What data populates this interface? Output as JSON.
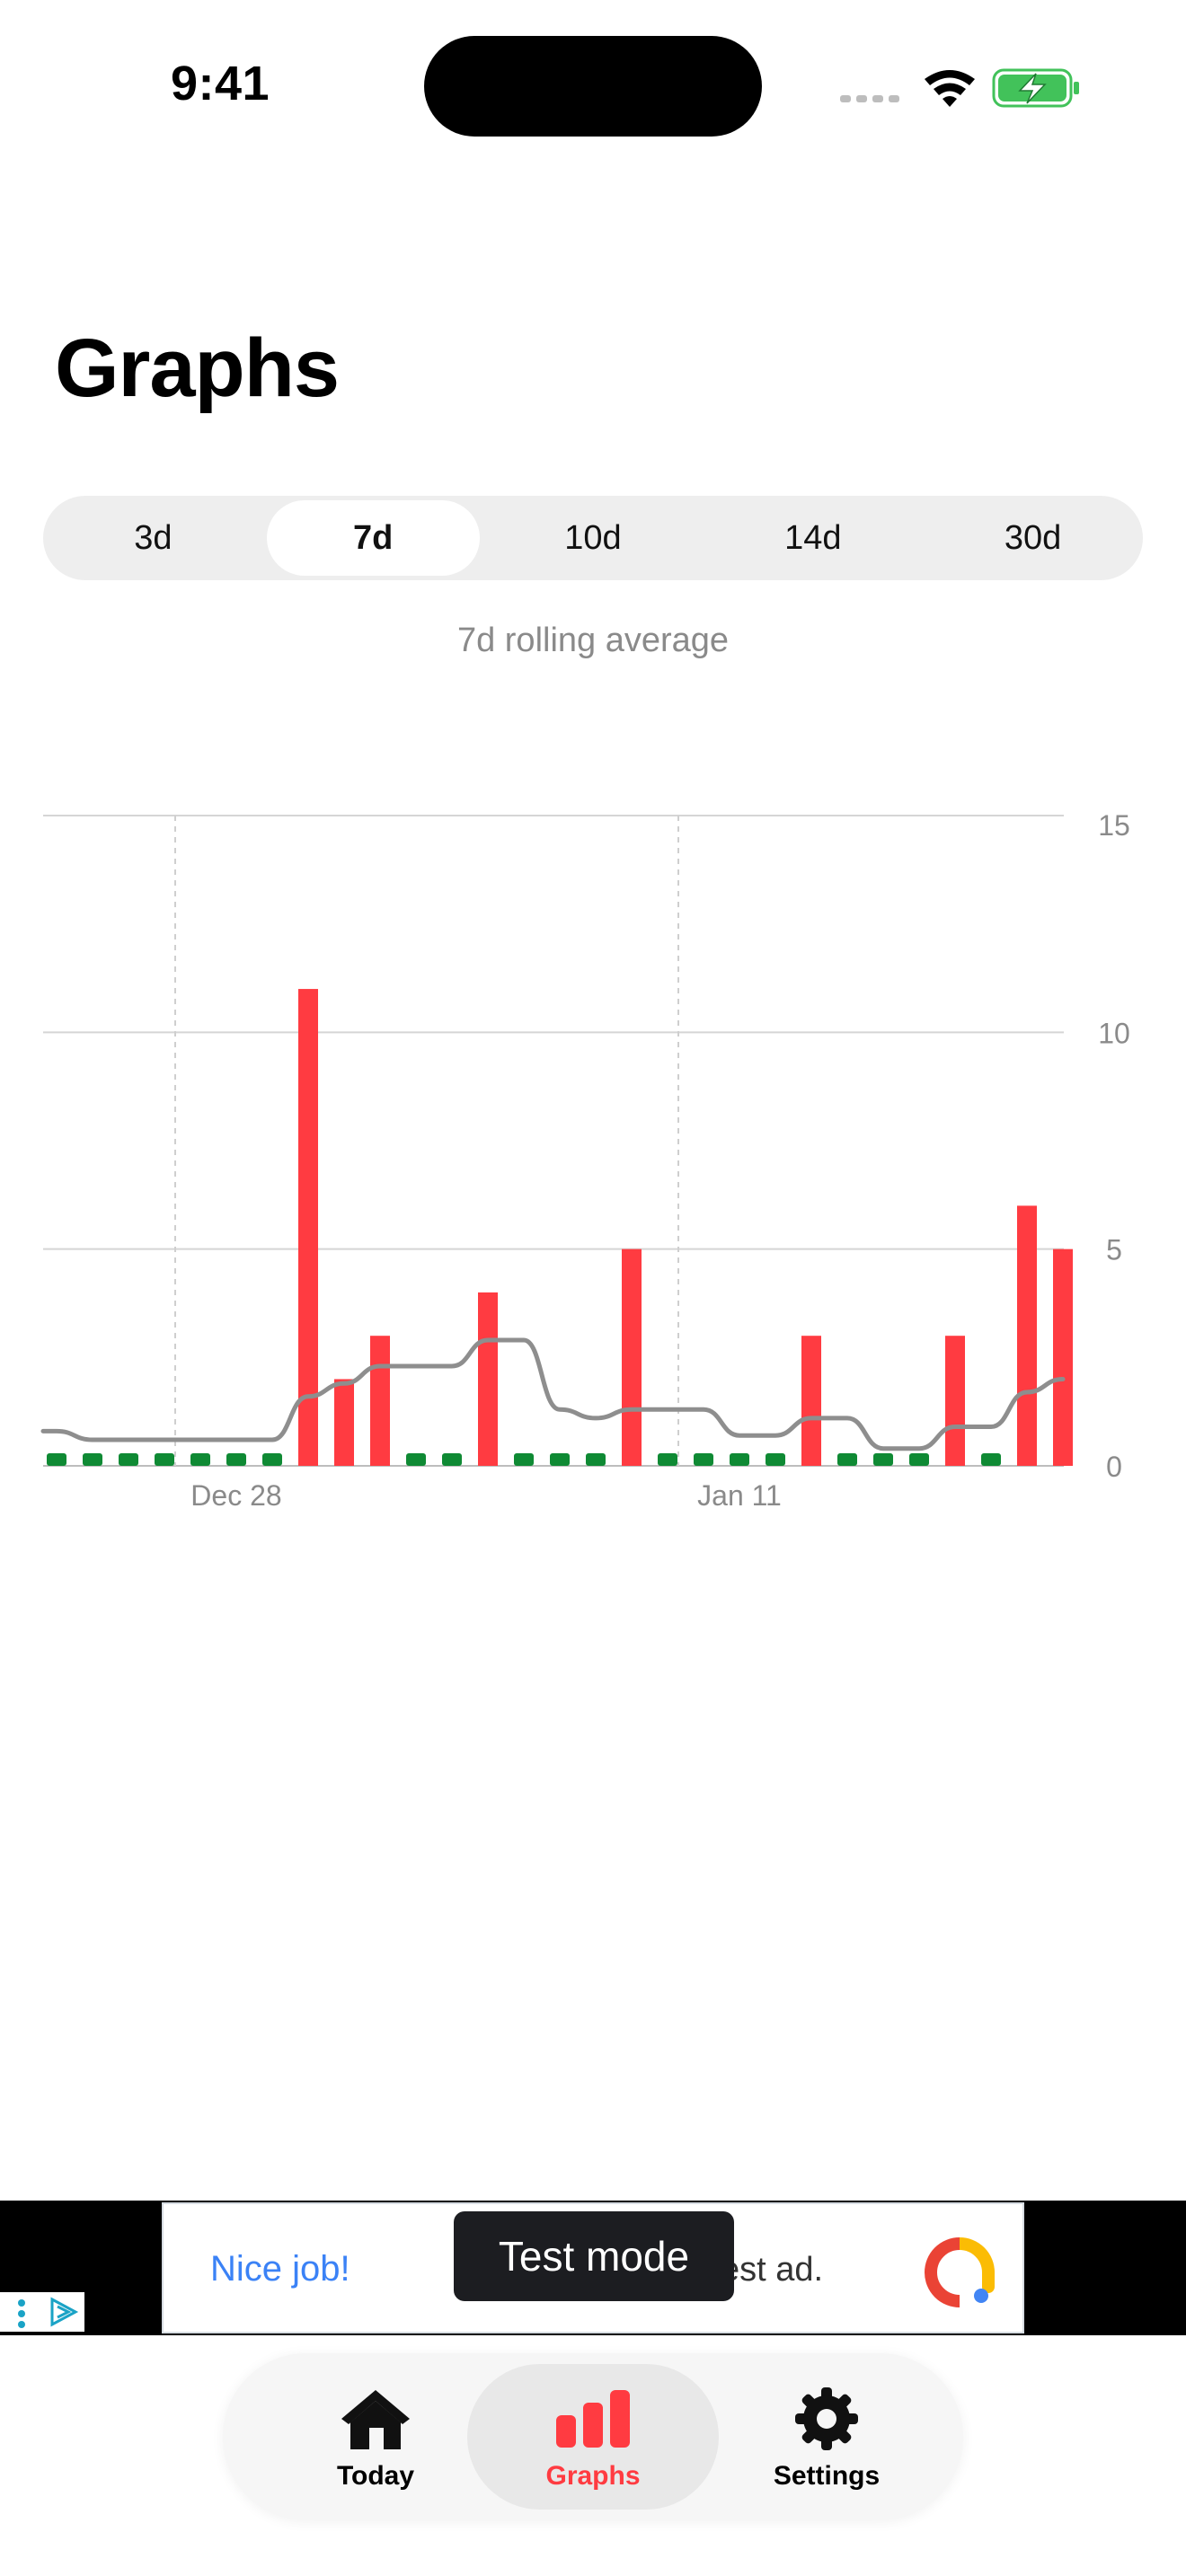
{
  "status_bar": {
    "time": "9:41"
  },
  "page": {
    "title": "Graphs",
    "subtitle": "7d rolling average"
  },
  "range_selector": {
    "options": [
      "3d",
      "7d",
      "10d",
      "14d",
      "30d"
    ],
    "selected": "7d"
  },
  "chart_data": {
    "type": "bar",
    "y_axis": {
      "ticks": [
        "15",
        "10",
        "5",
        "0"
      ],
      "ylim": [
        0,
        15
      ],
      "position": "right"
    },
    "x_axis": {
      "tick_labels": [
        "Dec 28",
        "Jan 11"
      ]
    },
    "grid": true,
    "values": [
      0,
      0,
      0,
      0,
      0,
      0,
      0,
      11,
      2,
      3,
      0,
      0,
      4,
      0,
      0,
      0,
      5,
      0,
      0,
      0,
      0,
      3,
      0,
      0,
      0,
      3,
      0,
      6,
      5
    ],
    "rolling_average": [
      0.8,
      0.6,
      0.6,
      0.6,
      0.6,
      0.6,
      0.6,
      1.6,
      1.9,
      2.3,
      2.3,
      2.3,
      2.9,
      2.9,
      1.3,
      1.1,
      1.3,
      1.3,
      1.3,
      0.7,
      0.7,
      1.1,
      1.1,
      0.4,
      0.4,
      0.9,
      0.9,
      1.7,
      2.0
    ],
    "colors": {
      "positive": "#ff3b41",
      "zero": "#0f8a34",
      "average_line": "#8e8e8e"
    }
  },
  "ad": {
    "headline": "Nice job!",
    "body_fragment": "est ad.",
    "toast": "Test mode"
  },
  "tab_bar": {
    "tabs": [
      {
        "label": "Today",
        "icon": "house-icon"
      },
      {
        "label": "Graphs",
        "icon": "bar-chart-icon"
      },
      {
        "label": "Settings",
        "icon": "gear-icon"
      }
    ],
    "active": "Graphs",
    "active_color": "#ff3b41"
  }
}
